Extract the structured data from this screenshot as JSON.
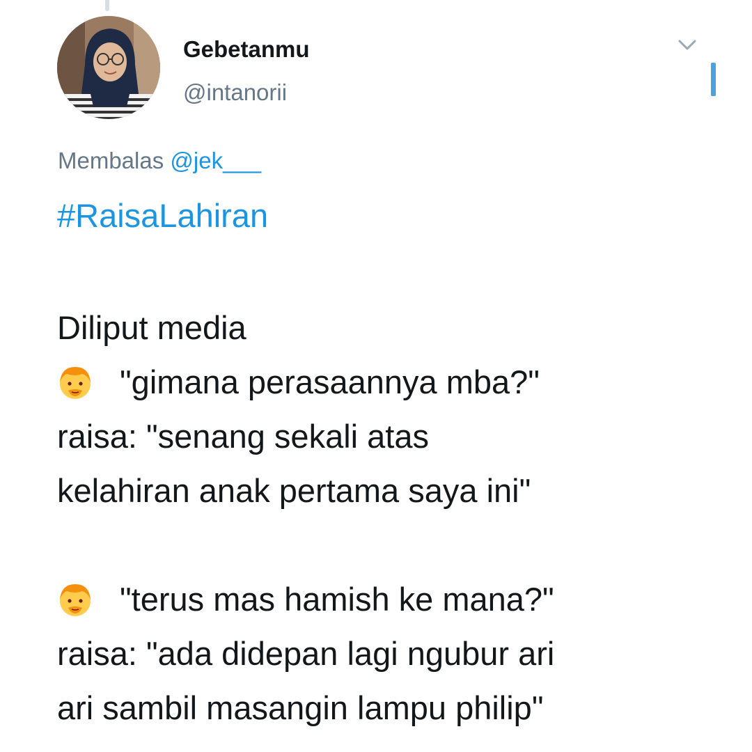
{
  "author": {
    "display_name": "Gebetanmu",
    "handle": "@intanorii"
  },
  "reply": {
    "prefix": "Membalas",
    "mention": "@jek___"
  },
  "hashtag": "#RaisaLahiran",
  "tweet_lines": {
    "l1": "Diliput media",
    "l2": "\"gimana perasaannya mba?\"",
    "l3": "raisa: \"senang sekali atas",
    "l4": "kelahiran anak pertama saya ini\"",
    "l5": "\"terus mas hamish ke mana?\"",
    "l6": "raisa: \"ada didepan lagi ngubur ari",
    "l7": "ari sambil masangin lampu philip\""
  },
  "icons": {
    "caret": "chevron-down-icon",
    "emoji": "man-face-emoji"
  },
  "colors": {
    "link": "#1b95e0",
    "secondary_text": "#657786",
    "primary_text": "#14171a",
    "emoji_face": "#ffcc4d",
    "emoji_hair": "#f4900c"
  }
}
